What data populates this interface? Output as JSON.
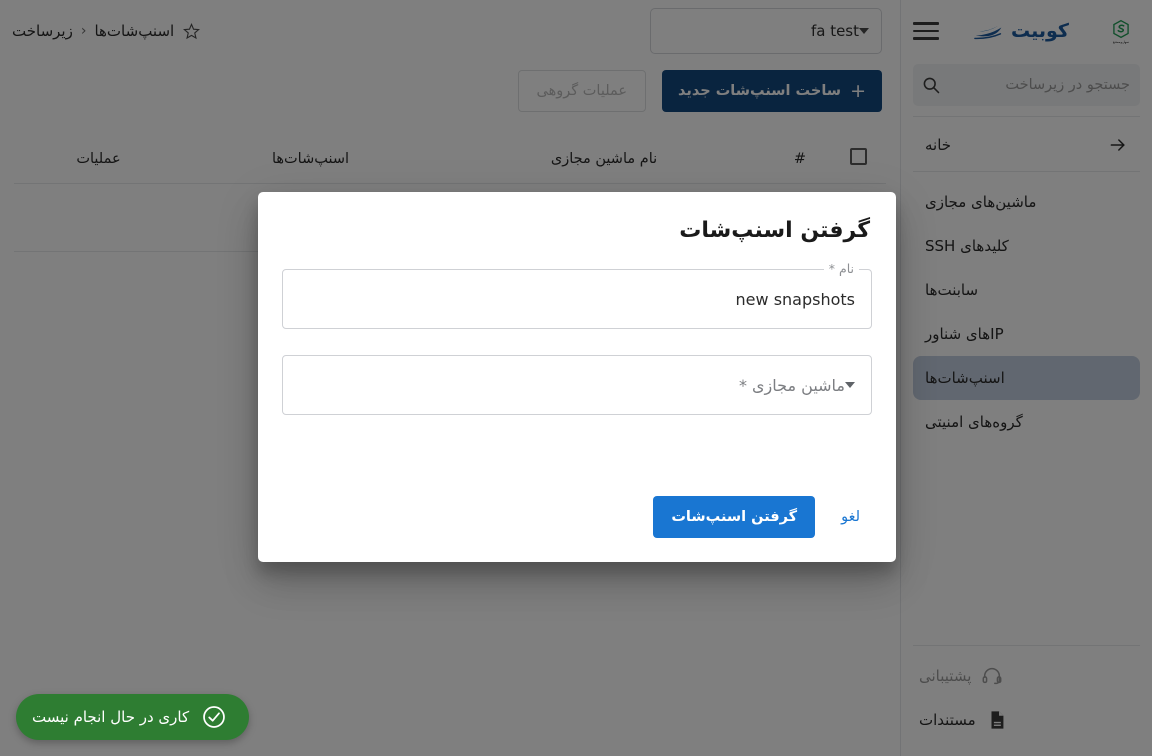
{
  "colors": {
    "brand_blue": "#1c5a9e",
    "primary_blue": "#1976d2",
    "dark_blue": "#13487e",
    "active_nav": "#c3cfe0",
    "toast_green": "#2e7d32",
    "secondary_logo_green": "#1f9d55"
  },
  "sidebar": {
    "brand": {
      "name": "کوبیت",
      "mark_icon": "speedboat-logo-icon"
    },
    "secondary_logo": {
      "icon": "snapp-s-logo-icon",
      "slogan": "سهل‌وممتنع"
    },
    "menu_icon": "hamburger-menu-icon",
    "search": {
      "placeholder": "جستجو در زیرساخت",
      "value": "",
      "icon": "search-icon"
    },
    "home": {
      "label": "خانه",
      "icon": "arrow-right-icon"
    },
    "items": [
      {
        "label": "ماشین‌های مجازی",
        "active": false
      },
      {
        "label": "کلیدهای SSH",
        "active": false
      },
      {
        "label": "سابنت‌ها",
        "active": false
      },
      {
        "label": "IPهای شناور",
        "active": false
      },
      {
        "label": "اسنپ‌شات‌ها",
        "active": true
      },
      {
        "label": "گروه‌های امنیتی",
        "active": false
      }
    ],
    "bottom_items": [
      {
        "label": "پشتیبانی",
        "icon": "headset-icon",
        "muted": true
      },
      {
        "label": "مستندات",
        "icon": "document-icon",
        "muted": false
      }
    ]
  },
  "topbar": {
    "tenant_select": {
      "value": "fa test",
      "icon": "chevron-down-icon"
    },
    "breadcrumb": {
      "parent": "زیرساخت",
      "separator": "‹",
      "current": "اسنپ‌شات‌ها",
      "favorite_icon": "star-outline-icon"
    }
  },
  "actions": {
    "create_label": "ساخت اسنپ‌شات جدید",
    "create_plus": "+",
    "bulk_label": "عملیات گروهی"
  },
  "table": {
    "headers": {
      "checkbox": "",
      "number": "#",
      "vm_name": "نام ماشین مجازی",
      "snapshots": "اسنپ‌شات‌ها",
      "operations": "عملیات"
    },
    "rows": []
  },
  "toast": {
    "message": "کاری در حال انجام نیست",
    "icon": "check-circle-icon"
  },
  "modal": {
    "title": "گرفتن اسنپ‌شات",
    "name_field": {
      "label": "نام *",
      "value": "new snapshots",
      "placeholder": ""
    },
    "vm_field": {
      "placeholder": "ماشین مجازی *",
      "value": "",
      "icon": "chevron-down-icon"
    },
    "submit_label": "گرفتن اسنپ‌شات",
    "cancel_label": "لغو"
  }
}
